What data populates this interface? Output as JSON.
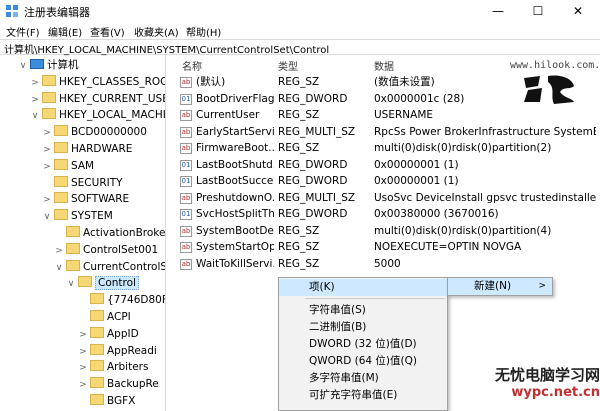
{
  "window": {
    "title": "注册表编辑器",
    "min_glyph": "—",
    "max_glyph": "☐",
    "close_glyph": "✕"
  },
  "menubar": [
    {
      "label": "文件(F)"
    },
    {
      "label": "编辑(E)"
    },
    {
      "label": "查看(V)"
    },
    {
      "label": "收藏夹(A)"
    },
    {
      "label": "帮助(H)"
    }
  ],
  "address": "计算机\\HKEY_LOCAL_MACHINE\\SYSTEM\\CurrentControlSet\\Control",
  "tree": [
    {
      "label": "计算机",
      "arrow": "∨",
      "icon": "computer-icon"
    },
    {
      "label": "HKEY_CLASSES_ROOT",
      "arrow": ">",
      "icon": "folder-icon"
    },
    {
      "label": "HKEY_CURRENT_USER",
      "arrow": ">",
      "icon": "folder-icon"
    },
    {
      "label": "HKEY_LOCAL_MACHINE",
      "arrow": "∨",
      "icon": "folder-icon"
    },
    {
      "label": "BCD00000000",
      "arrow": ">",
      "icon": "folder-icon"
    },
    {
      "label": "HARDWARE",
      "arrow": ">",
      "icon": "folder-icon"
    },
    {
      "label": "SAM",
      "arrow": ">",
      "icon": "folder-icon"
    },
    {
      "label": "SECURITY",
      "arrow": "",
      "icon": "folder-icon"
    },
    {
      "label": "SOFTWARE",
      "arrow": ">",
      "icon": "folder-icon"
    },
    {
      "label": "SYSTEM",
      "arrow": "∨",
      "icon": "folder-icon"
    },
    {
      "label": "ActivationBroker",
      "arrow": "",
      "icon": "folder-icon"
    },
    {
      "label": "ControlSet001",
      "arrow": ">",
      "icon": "folder-icon"
    },
    {
      "label": "CurrentControlSet",
      "arrow": "∨",
      "icon": "folder-icon"
    },
    {
      "label": "Control",
      "arrow": "∨",
      "icon": "folder-icon",
      "selected": true
    },
    {
      "label": "{7746D80F",
      "arrow": "",
      "icon": "folder-icon"
    },
    {
      "label": "ACPI",
      "arrow": "",
      "icon": "folder-icon"
    },
    {
      "label": "AppID",
      "arrow": ">",
      "icon": "folder-icon"
    },
    {
      "label": "AppReadi",
      "arrow": ">",
      "icon": "folder-icon"
    },
    {
      "label": "Arbiters",
      "arrow": ">",
      "icon": "folder-icon"
    },
    {
      "label": "BackupRe",
      "arrow": ">",
      "icon": "folder-icon"
    },
    {
      "label": "BGFX",
      "arrow": "",
      "icon": "folder-icon"
    }
  ],
  "columns": {
    "name": "名称",
    "type": "类型",
    "data": "数据"
  },
  "values": [
    {
      "name": "(默认)",
      "type": "REG_SZ",
      "data": "(数值未设置)",
      "icon": "ab"
    },
    {
      "name": "BootDriverFlags",
      "type": "REG_DWORD",
      "data": "0x0000001c (28)",
      "icon": "bin"
    },
    {
      "name": "CurrentUser",
      "type": "REG_SZ",
      "data": "USERNAME",
      "icon": "ab"
    },
    {
      "name": "EarlyStartServi...",
      "type": "REG_MULTI_SZ",
      "data": "RpcSs Power BrokerInfrastructure SystemEve...",
      "icon": "ab"
    },
    {
      "name": "FirmwareBoot...",
      "type": "REG_SZ",
      "data": "multi(0)disk(0)rdisk(0)partition(2)",
      "icon": "ab"
    },
    {
      "name": "LastBootShutd...",
      "type": "REG_DWORD",
      "data": "0x00000001 (1)",
      "icon": "bin"
    },
    {
      "name": "LastBootSucce...",
      "type": "REG_DWORD",
      "data": "0x00000001 (1)",
      "icon": "bin"
    },
    {
      "name": "PreshutdownO...",
      "type": "REG_MULTI_SZ",
      "data": "UsoSvc DeviceInstall gpsvc trustedinstaller",
      "icon": "ab"
    },
    {
      "name": "SvcHostSplitTh...",
      "type": "REG_DWORD",
      "data": "0x00380000 (3670016)",
      "icon": "bin"
    },
    {
      "name": "SystemBootDe...",
      "type": "REG_SZ",
      "data": "multi(0)disk(0)rdisk(0)partition(4)",
      "icon": "ab"
    },
    {
      "name": "SystemStartOp...",
      "type": "REG_SZ",
      "data": " NOEXECUTE=OPTIN  NOVGA",
      "icon": "ab"
    },
    {
      "name": "WaitToKillServi...",
      "type": "REG_SZ",
      "data": "5000",
      "icon": "ab"
    }
  ],
  "context_menu": [
    {
      "label": "项(K)",
      "highlight": true
    },
    {
      "label": "字符串值(S)"
    },
    {
      "label": "二进制值(B)"
    },
    {
      "label": "DWORD (32 位)值(D)"
    },
    {
      "label": "QWORD (64 位)值(Q)"
    },
    {
      "label": "多字符串值(M)"
    },
    {
      "label": "可扩充字符串值(E)"
    }
  ],
  "submenu": {
    "label": "新建(N)",
    "arrow": ">"
  },
  "watermark": {
    "url": "www.hilook.com.cn",
    "brand_line1": "无忧电脑学习网",
    "brand_line2": "wypc.net.cn"
  }
}
